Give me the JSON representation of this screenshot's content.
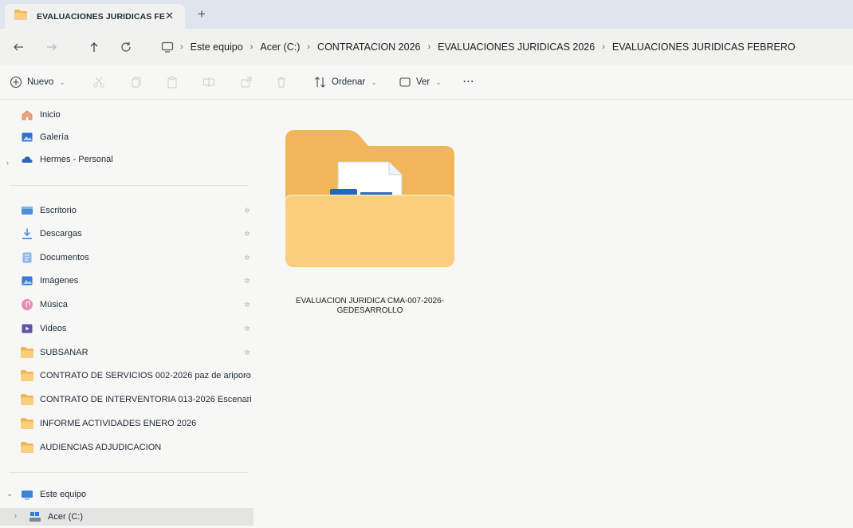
{
  "tab": {
    "title": "EVALUACIONES JURIDICAS FE",
    "close": "✕",
    "new_tab": "+"
  },
  "breadcrumb": [
    "Este equipo",
    "Acer (C:)",
    "CONTRATACION 2026",
    "EVALUACIONES JURIDICAS 2026",
    "EVALUACIONES JURIDICAS FEBRERO"
  ],
  "breadcrumb_separator": "›",
  "toolbar": {
    "new_label": "Nuevo",
    "sort_label": "Ordenar",
    "view_label": "Ver",
    "more_label": "···"
  },
  "sidebar": {
    "top_items": [
      {
        "label": "Inicio",
        "icon": "home-icon"
      },
      {
        "label": "Galería",
        "icon": "gallery-icon"
      },
      {
        "label": "Hermes - Personal",
        "icon": "cloud-icon"
      }
    ],
    "quick_items": [
      {
        "label": "Escritorio",
        "icon": "desktop-icon"
      },
      {
        "label": "Descargas",
        "icon": "download-icon"
      },
      {
        "label": "Documentos",
        "icon": "document-icon"
      },
      {
        "label": "Imágenes",
        "icon": "image-icon"
      },
      {
        "label": "Música",
        "icon": "music-icon"
      },
      {
        "label": "Videos",
        "icon": "video-icon"
      },
      {
        "label": "SUBSANAR",
        "icon": "folder-icon"
      },
      {
        "label": "CONTRATO DE SERVICIOS 002-2026 paz de ariporo",
        "icon": "folder-icon"
      },
      {
        "label": "CONTRATO DE INTERVENTORIA 013-2026 Escenari",
        "icon": "folder-icon"
      },
      {
        "label": "INFORME ACTIVIDADES ENERO 2026",
        "icon": "folder-icon"
      },
      {
        "label": "AUDIENCIAS ADJUDICACION",
        "icon": "folder-icon"
      }
    ],
    "this_pc": {
      "label": "Este equipo",
      "icon": "computer-icon"
    },
    "drive": {
      "label": "Acer (C:)",
      "icon": "drive-icon"
    }
  },
  "content": {
    "items": [
      {
        "name_line1": "EVALUACION JURIDICA CMA-007-2026-",
        "name_line2": "GEDESARROLLO",
        "type": "folder"
      }
    ]
  },
  "colors": {
    "folder_back": "#f2b65a",
    "folder_front": "#f9cf7e",
    "accent": "#1a6fc4"
  }
}
